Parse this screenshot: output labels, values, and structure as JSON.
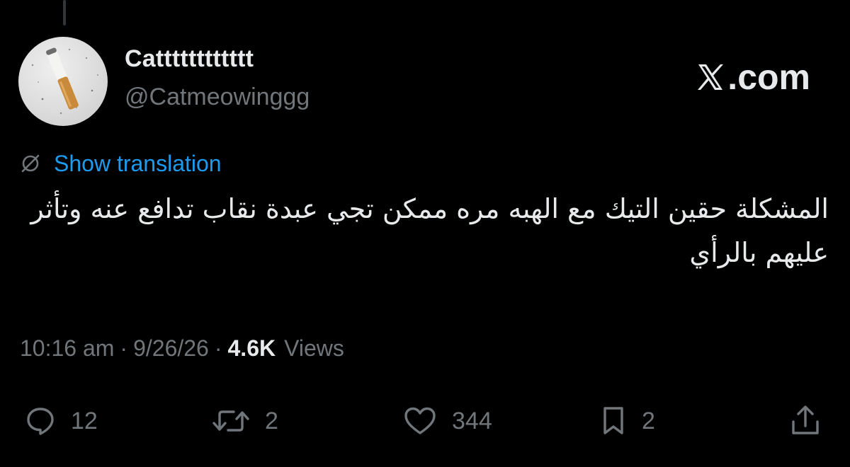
{
  "tweet": {
    "display_name": "Catttttttttttt",
    "handle": "@Catmeowinggg",
    "brand": ".com",
    "translate_label": "Show translation",
    "text": "المشكلة حقين التيك مع الهبه مره ممكن تجي عبدة نقاب تدافع عنه وتأثر عليهم بالرأي",
    "time": "10:16 am",
    "date": "9/26/26",
    "separator": "·",
    "views_count": "4.6K",
    "views_label": "Views"
  },
  "actions": {
    "replies": "12",
    "reposts": "2",
    "likes": "344",
    "bookmarks": "2"
  },
  "icons": {
    "avatar": "cigarette-avatar",
    "brand_logo": "x-logo-icon",
    "translate": "globe-slash-icon",
    "reply": "reply-icon",
    "repost": "repost-icon",
    "like": "heart-icon",
    "bookmark": "bookmark-icon",
    "share": "share-icon"
  },
  "colors": {
    "background": "#000000",
    "text_primary": "#e7e9ea",
    "text_secondary": "#71767b",
    "link": "#1d9bf0"
  }
}
